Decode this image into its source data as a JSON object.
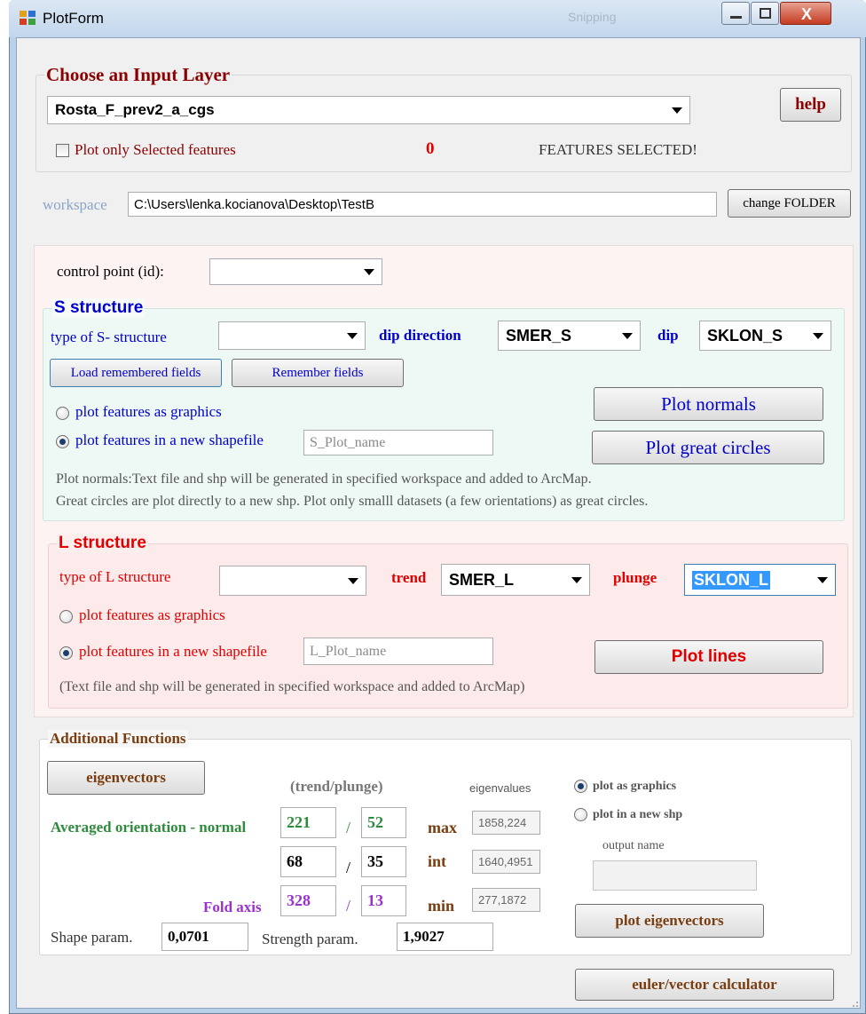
{
  "window": {
    "title": "PlotForm",
    "bg_title_hint": "Snipping"
  },
  "input_layer": {
    "legend": "Choose an Input Layer",
    "layer_value": "Rosta_F_prev2_a_cgs",
    "help_label": "help",
    "plot_selected_label": "Plot only Selected features",
    "selected_count": "0",
    "features_selected_label": "FEATURES SELECTED!"
  },
  "workspace": {
    "label": "workspace",
    "path": "C:\\Users\\lenka.kocianova\\Desktop\\TestB",
    "change_label": "change FOLDER"
  },
  "control_point": {
    "label": "control point (id):",
    "value": ""
  },
  "s_structure": {
    "legend": "S structure",
    "type_label": "type of S- structure",
    "type_value": "",
    "dip_direction_label": "dip direction",
    "dip_direction_value": "SMER_S",
    "dip_label": "dip",
    "dip_value": "SKLON_S",
    "load_label": "Load remembered fields",
    "remember_label": "Remember fields",
    "graphics_label": "plot features as graphics",
    "shapefile_label": "plot features in a new shapefile",
    "shapefile_placeholder": "S_Plot_name",
    "plot_normals_label": "Plot normals",
    "plot_circles_label": "Plot great circles",
    "note1": "Plot normals:Text file and shp will be generated in specified workspace and added to ArcMap.",
    "note2": "Great circles are plot directly to a new shp. Plot only smalll datasets (a few orientations) as great circles."
  },
  "l_structure": {
    "legend": "L structure",
    "type_label": "type of L structure",
    "type_value": "",
    "trend_label": "trend",
    "trend_value": "SMER_L",
    "plunge_label": "plunge",
    "plunge_value": "SKLON_L",
    "graphics_label": "plot features as graphics",
    "shapefile_label": "plot features in a new shapefile",
    "shapefile_placeholder": "L_Plot_name",
    "plot_lines_label": "Plot lines",
    "note": "(Text file and shp will be generated in specified workspace and added to ArcMap)"
  },
  "additional": {
    "legend": "Additional Functions",
    "eigenvectors_label": "eigenvectors",
    "trend_plunge_header": "(trend/plunge)",
    "eigenvalues_header": "eigenvalues",
    "averaged_label": "Averaged orientation - normal",
    "fold_axis_label": "Fold axis",
    "rows": [
      {
        "trend": "221",
        "plunge": "52",
        "kind": "max",
        "eigen": "1858,224"
      },
      {
        "trend": "68",
        "plunge": "35",
        "kind": "int",
        "eigen": "1640,4951"
      },
      {
        "trend": "328",
        "plunge": "13",
        "kind": "min",
        "eigen": "277,1872"
      }
    ],
    "separator": "/",
    "plot_graphics_label": "plot as graphics",
    "plot_shp_label": "plot in a new shp",
    "output_name_label": "output name",
    "output_name_value": "",
    "plot_eigenvectors_label": "plot eigenvectors",
    "shape_param_label": "Shape param.",
    "shape_param_value": "0,0701",
    "strength_param_label": "Strength param.",
    "strength_param_value": "1,9027",
    "euler_label": "euler/vector calculator"
  },
  "colors": {
    "dark_red": "#8b0000",
    "blue": "#0000cc",
    "red": "#e00000",
    "green": "#2e8b3c",
    "purple": "#9932cc",
    "brown": "#7a3d10",
    "s_panel": "#eef9f5",
    "l_panel": "#fdeaea",
    "mid_panel": "#fdf3f3"
  }
}
